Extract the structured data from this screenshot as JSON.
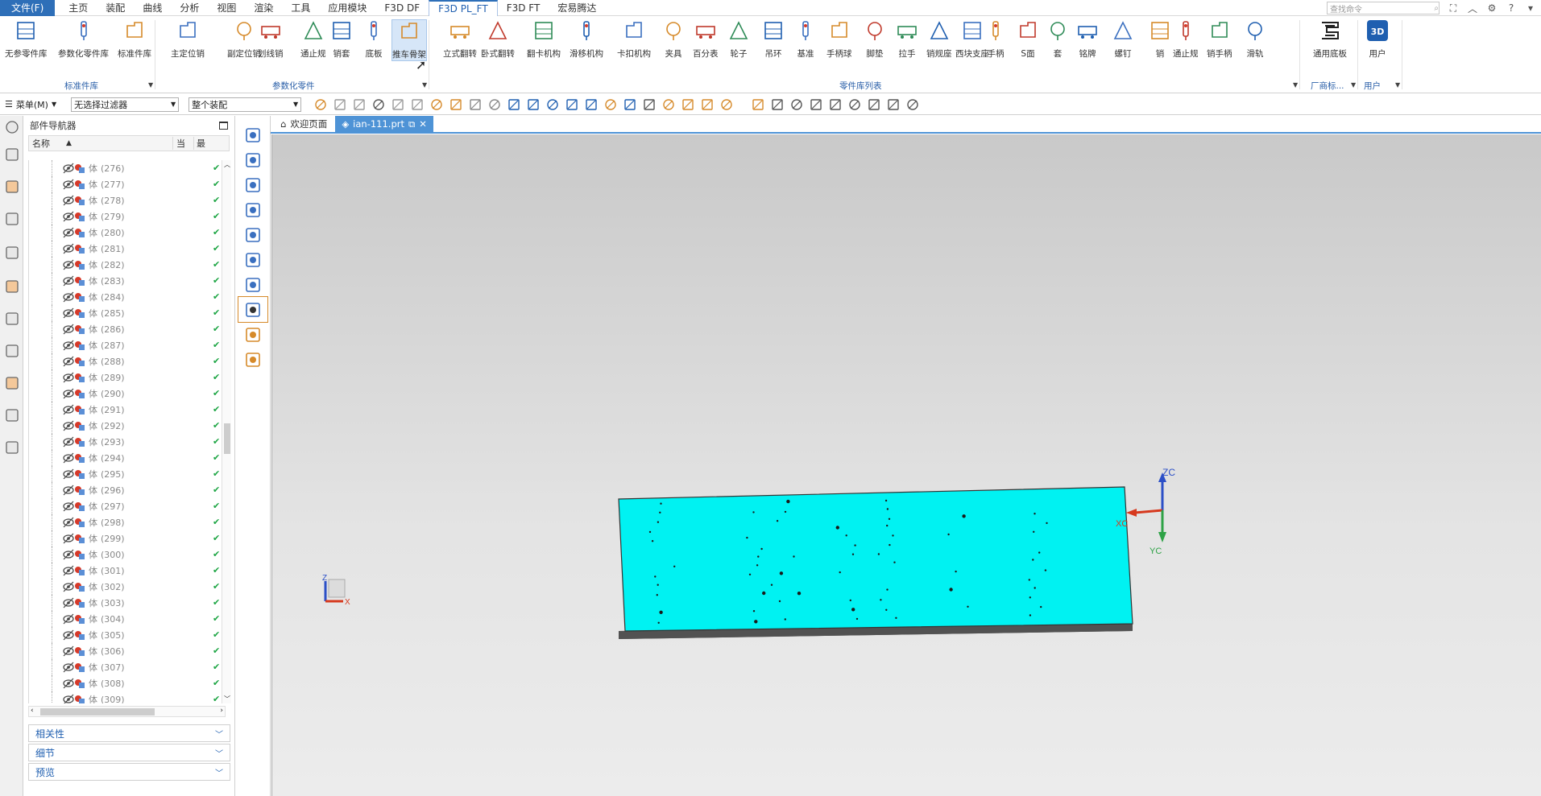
{
  "menubar": {
    "file_label": "文件(F)",
    "tabs": [
      "主页",
      "装配",
      "曲线",
      "分析",
      "视图",
      "渲染",
      "工具",
      "应用模块",
      "F3D DF",
      "F3D PL_FT",
      "F3D FT",
      "宏易腾达"
    ],
    "active_tab": "F3D PL_FT",
    "search_placeholder": "查找命令"
  },
  "ribbon": {
    "groups": [
      {
        "label": "标准件库",
        "items": [
          "无参零件库",
          "参数化零件库",
          "标准件库"
        ]
      },
      {
        "label": "参数化零件",
        "items": [
          "主定位销",
          "副定位销",
          "划线销",
          "通止规",
          "销套",
          "底板",
          "推车骨架"
        ]
      },
      {
        "label": "零件库列表",
        "items": [
          "立式翻转",
          "卧式翻转",
          "翻卡机构",
          "滑移机构",
          "卡扣机构",
          "夹具",
          "百分表",
          "轮子",
          "吊环",
          "基准",
          "手柄球",
          "脚垫",
          "拉手",
          "销规座",
          "西块支座",
          "手柄",
          "S面",
          "套",
          "铭牌",
          "螺钉",
          "销",
          "通止规",
          "销手柄",
          "滑轨"
        ]
      },
      {
        "label": "厂商标...",
        "items": [
          "通用底板"
        ]
      },
      {
        "label": "用户",
        "items": [
          "用户"
        ]
      }
    ],
    "active_item": "推车骨架"
  },
  "toolbar2": {
    "menu_label": "菜单(M)",
    "filter_value": "无选择过滤器",
    "scope_value": "整个装配"
  },
  "navigator": {
    "title": "部件导航器",
    "columns": {
      "name": "名称",
      "current": "当",
      "latest": "最"
    },
    "row_prefix": "体",
    "rows": [
      "(276)",
      "(277)",
      "(278)",
      "(279)",
      "(280)",
      "(281)",
      "(282)",
      "(283)",
      "(284)",
      "(285)",
      "(286)",
      "(287)",
      "(288)",
      "(289)",
      "(290)",
      "(291)",
      "(292)",
      "(293)",
      "(294)",
      "(295)",
      "(296)",
      "(297)",
      "(298)",
      "(299)",
      "(300)",
      "(301)",
      "(302)",
      "(303)",
      "(304)",
      "(305)",
      "(306)",
      "(307)",
      "(308)",
      "(309)"
    ],
    "panels": [
      "相关性",
      "细节",
      "预览"
    ]
  },
  "doc_tabs": [
    {
      "label": "欢迎页面",
      "active": false
    },
    {
      "label": "ian-111.prt",
      "active": true
    }
  ],
  "viewport": {
    "axis_labels": {
      "zc": "ZC",
      "xc": "XC",
      "yc": "YC",
      "z": "Z",
      "x": "X"
    },
    "plate_color": "#00f2f2"
  },
  "colors": {
    "accent": "#2e6fb8",
    "tab_active": "#4e93d6",
    "check": "#1da544"
  }
}
